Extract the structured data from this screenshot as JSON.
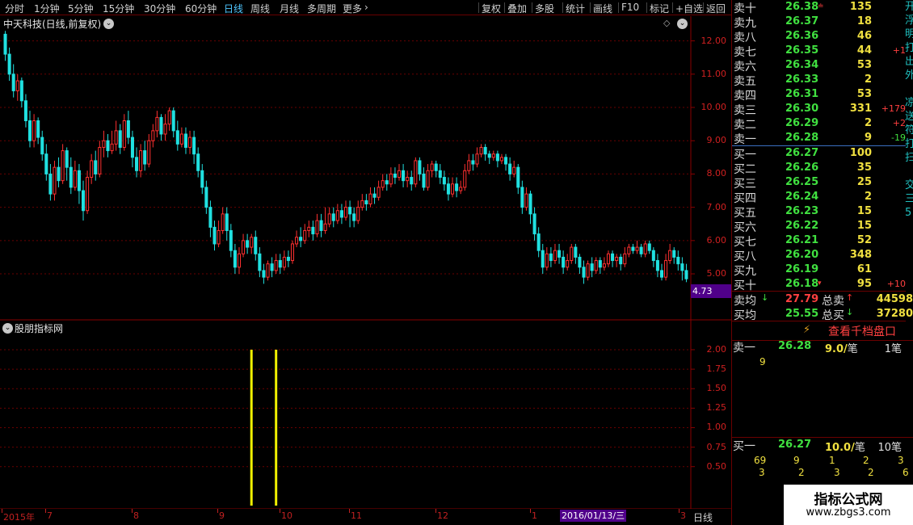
{
  "toolbar": {
    "left": [
      "分时",
      "1分钟",
      "5分钟",
      "15分钟",
      "30分钟",
      "60分钟",
      "日线",
      "周线",
      "月线",
      "多周期",
      "更多"
    ],
    "active": "日线",
    "right": [
      "复权",
      "叠加",
      "多股",
      "统计",
      "画线",
      "F10",
      "标记",
      "+自选",
      "返回"
    ]
  },
  "chart": {
    "title": "中天科技(日线,前复权)",
    "price_axis": [
      "12.00",
      "11.00",
      "10.00",
      "9.00",
      "8.00",
      "7.00",
      "6.00",
      "5.00"
    ],
    "last_price_tag": "4.73",
    "indicator_title": "股朋指标网",
    "indicator_axis": [
      "2.00",
      "1.75",
      "1.50",
      "1.25",
      "1.00",
      "0.75",
      "0.50"
    ],
    "dates": [
      "2015年",
      "7",
      "8",
      "9",
      "10",
      "11",
      "12",
      "1",
      "3"
    ],
    "cursor_date": "2016/01/13/三",
    "period": "日线"
  },
  "chart_data": {
    "type": "candlestick",
    "ylim": [
      4.2,
      12.5
    ],
    "candles": [
      [
        12.2,
        11.6,
        12.3,
        11.4
      ],
      [
        11.6,
        11.0,
        11.8,
        10.8
      ],
      [
        11.0,
        10.5,
        11.3,
        10.3
      ],
      [
        10.5,
        10.8,
        11.0,
        10.2
      ],
      [
        10.8,
        10.2,
        10.9,
        10.0
      ],
      [
        10.2,
        9.6,
        10.4,
        9.4
      ],
      [
        9.6,
        9.0,
        9.9,
        8.8
      ],
      [
        9.0,
        9.6,
        9.8,
        8.8
      ],
      [
        9.6,
        9.1,
        9.7,
        8.9
      ],
      [
        9.1,
        8.6,
        9.3,
        8.4
      ],
      [
        8.6,
        8.0,
        8.9,
        7.8
      ],
      [
        8.0,
        7.4,
        8.3,
        7.2
      ],
      [
        7.4,
        8.2,
        8.4,
        7.2
      ],
      [
        8.2,
        7.8,
        8.5,
        7.6
      ],
      [
        7.8,
        8.7,
        8.9,
        7.7
      ],
      [
        8.7,
        8.2,
        8.8,
        7.8
      ],
      [
        8.2,
        7.6,
        8.5,
        7.4
      ],
      [
        7.6,
        8.1,
        8.4,
        7.5
      ],
      [
        8.1,
        7.5,
        8.3,
        7.1
      ],
      [
        7.5,
        6.9,
        7.8,
        6.6
      ],
      [
        6.9,
        7.9,
        8.1,
        6.8
      ],
      [
        7.9,
        8.4,
        8.6,
        7.7
      ],
      [
        8.4,
        8.0,
        8.7,
        7.8
      ],
      [
        8.0,
        8.8,
        9.0,
        7.9
      ],
      [
        8.8,
        9.0,
        9.3,
        8.5
      ],
      [
        9.0,
        8.7,
        9.2,
        8.5
      ],
      [
        8.7,
        8.9,
        9.3,
        8.6
      ],
      [
        8.9,
        9.3,
        9.6,
        8.7
      ],
      [
        9.3,
        8.8,
        9.5,
        8.6
      ],
      [
        8.8,
        9.6,
        9.8,
        8.7
      ],
      [
        9.6,
        9.1,
        9.9,
        8.9
      ],
      [
        9.1,
        8.5,
        9.3,
        8.2
      ],
      [
        8.5,
        8.1,
        8.8,
        7.9
      ],
      [
        8.1,
        8.7,
        8.9,
        7.9
      ],
      [
        8.7,
        8.3,
        9.0,
        8.1
      ],
      [
        8.3,
        9.0,
        9.2,
        8.2
      ],
      [
        9.0,
        9.3,
        9.5,
        8.8
      ],
      [
        9.3,
        9.7,
        9.9,
        9.1
      ],
      [
        9.7,
        9.2,
        9.8,
        9.0
      ],
      [
        9.2,
        9.5,
        9.8,
        9.0
      ],
      [
        9.5,
        9.9,
        10.0,
        9.3
      ],
      [
        9.9,
        9.3,
        10.0,
        9.1
      ],
      [
        9.3,
        8.9,
        9.6,
        8.7
      ],
      [
        8.9,
        9.2,
        9.4,
        8.8
      ],
      [
        9.2,
        8.8,
        9.4,
        8.6
      ],
      [
        8.8,
        9.1,
        9.3,
        8.6
      ],
      [
        9.1,
        8.6,
        9.3,
        8.3
      ],
      [
        8.6,
        8.1,
        8.8,
        7.9
      ],
      [
        8.1,
        7.6,
        8.3,
        7.4
      ],
      [
        7.6,
        7.0,
        7.8,
        6.8
      ],
      [
        7.0,
        6.4,
        7.2,
        6.1
      ],
      [
        6.4,
        5.9,
        6.6,
        5.7
      ],
      [
        5.9,
        6.3,
        6.6,
        5.8
      ],
      [
        6.3,
        6.8,
        7.0,
        6.2
      ],
      [
        6.8,
        6.3,
        7.0,
        6.0
      ],
      [
        6.3,
        5.7,
        6.5,
        5.5
      ],
      [
        5.7,
        5.2,
        5.9,
        5.0
      ],
      [
        5.2,
        5.6,
        5.8,
        5.0
      ],
      [
        5.6,
        6.0,
        6.2,
        5.5
      ],
      [
        6.0,
        5.8,
        6.2,
        5.6
      ],
      [
        5.8,
        6.1,
        6.2,
        5.6
      ],
      [
        6.1,
        5.6,
        6.3,
        5.4
      ],
      [
        5.6,
        5.1,
        5.8,
        4.9
      ],
      [
        5.1,
        4.9,
        5.3,
        4.7
      ],
      [
        4.9,
        5.3,
        5.4,
        4.8
      ],
      [
        5.3,
        5.1,
        5.5,
        4.9
      ],
      [
        5.1,
        5.4,
        5.6,
        5.0
      ],
      [
        5.4,
        5.2,
        5.6,
        5.0
      ],
      [
        5.2,
        5.5,
        5.7,
        5.1
      ],
      [
        5.5,
        5.4,
        5.7,
        5.2
      ],
      [
        5.4,
        5.9,
        6.0,
        5.3
      ],
      [
        5.9,
        6.1,
        6.3,
        5.8
      ],
      [
        6.1,
        6.0,
        6.4,
        5.8
      ],
      [
        6.0,
        6.3,
        6.5,
        5.9
      ],
      [
        6.3,
        6.4,
        6.6,
        6.1
      ],
      [
        6.4,
        6.2,
        6.6,
        6.0
      ],
      [
        6.2,
        6.6,
        6.8,
        6.1
      ],
      [
        6.6,
        6.3,
        6.8,
        6.1
      ],
      [
        6.3,
        6.5,
        7.0,
        6.2
      ],
      [
        6.5,
        6.8,
        7.0,
        6.4
      ],
      [
        6.8,
        6.6,
        7.0,
        6.4
      ],
      [
        6.6,
        6.9,
        7.1,
        6.5
      ],
      [
        6.9,
        6.7,
        7.1,
        6.5
      ],
      [
        6.7,
        7.0,
        7.2,
        6.6
      ],
      [
        7.0,
        6.8,
        7.2,
        6.4
      ],
      [
        6.8,
        6.6,
        7.0,
        6.4
      ],
      [
        6.6,
        7.0,
        7.2,
        6.5
      ],
      [
        7.0,
        7.2,
        7.4,
        6.9
      ],
      [
        7.2,
        7.1,
        7.4,
        6.9
      ],
      [
        7.1,
        7.4,
        7.6,
        7.0
      ],
      [
        7.4,
        7.3,
        7.6,
        7.1
      ],
      [
        7.3,
        7.6,
        7.8,
        7.2
      ],
      [
        7.6,
        7.8,
        8.0,
        7.5
      ],
      [
        7.8,
        7.7,
        8.0,
        7.5
      ],
      [
        7.7,
        8.0,
        8.2,
        7.6
      ],
      [
        8.0,
        7.9,
        8.2,
        7.7
      ],
      [
        7.9,
        8.1,
        8.3,
        7.8
      ],
      [
        8.1,
        7.8,
        8.3,
        7.6
      ],
      [
        7.8,
        7.9,
        8.1,
        7.6
      ],
      [
        7.9,
        7.7,
        8.1,
        7.5
      ],
      [
        7.7,
        8.4,
        8.5,
        7.6
      ],
      [
        8.4,
        8.0,
        8.5,
        7.8
      ],
      [
        8.0,
        7.6,
        8.2,
        7.5
      ],
      [
        7.6,
        8.1,
        8.3,
        7.5
      ],
      [
        8.1,
        8.3,
        8.4,
        7.9
      ],
      [
        8.3,
        8.1,
        8.4,
        7.9
      ],
      [
        8.1,
        7.9,
        8.3,
        7.7
      ],
      [
        7.9,
        7.7,
        8.1,
        7.5
      ],
      [
        7.7,
        7.4,
        7.9,
        7.2
      ],
      [
        7.4,
        7.7,
        7.9,
        7.3
      ],
      [
        7.7,
        7.5,
        7.9,
        7.3
      ],
      [
        7.5,
        7.6,
        7.8,
        7.4
      ],
      [
        7.6,
        8.1,
        8.3,
        7.5
      ],
      [
        8.1,
        8.4,
        8.6,
        8.0
      ],
      [
        8.4,
        8.3,
        8.6,
        8.1
      ],
      [
        8.3,
        8.6,
        8.8,
        8.2
      ],
      [
        8.6,
        8.8,
        8.9,
        8.5
      ],
      [
        8.8,
        8.6,
        8.9,
        8.4
      ],
      [
        8.6,
        8.5,
        8.7,
        8.3
      ],
      [
        8.5,
        8.6,
        8.7,
        8.4
      ],
      [
        8.6,
        8.4,
        8.7,
        8.2
      ],
      [
        8.4,
        8.5,
        8.6,
        8.3
      ],
      [
        8.5,
        8.3,
        8.6,
        8.1
      ],
      [
        8.3,
        8.0,
        8.5,
        7.8
      ],
      [
        8.0,
        8.2,
        8.4,
        7.9
      ],
      [
        8.2,
        7.6,
        8.3,
        7.4
      ],
      [
        7.6,
        7.0,
        7.8,
        6.8
      ],
      [
        7.0,
        7.4,
        7.6,
        6.9
      ],
      [
        7.4,
        6.8,
        7.5,
        6.5
      ],
      [
        6.8,
        6.2,
        7.0,
        6.0
      ],
      [
        6.2,
        5.7,
        6.4,
        5.5
      ],
      [
        5.7,
        5.2,
        5.9,
        5.0
      ],
      [
        5.2,
        5.6,
        5.8,
        5.1
      ],
      [
        5.6,
        5.4,
        5.8,
        5.2
      ],
      [
        5.4,
        5.7,
        5.9,
        5.3
      ],
      [
        5.7,
        5.5,
        5.9,
        5.3
      ],
      [
        5.5,
        5.2,
        5.7,
        5.0
      ],
      [
        5.2,
        5.4,
        5.6,
        5.1
      ],
      [
        5.4,
        5.8,
        5.9,
        5.3
      ],
      [
        5.8,
        5.5,
        5.9,
        5.3
      ],
      [
        5.5,
        5.2,
        5.6,
        5.0
      ],
      [
        5.2,
        4.9,
        5.4,
        4.7
      ],
      [
        4.9,
        5.3,
        5.4,
        4.8
      ],
      [
        5.3,
        5.1,
        5.5,
        4.9
      ],
      [
        5.1,
        5.4,
        5.5,
        5.0
      ],
      [
        5.4,
        5.2,
        5.5,
        5.0
      ],
      [
        5.2,
        5.3,
        5.5,
        5.1
      ],
      [
        5.3,
        5.6,
        5.7,
        5.2
      ],
      [
        5.6,
        5.4,
        5.7,
        5.2
      ],
      [
        5.4,
        5.5,
        5.6,
        5.2
      ],
      [
        5.5,
        5.3,
        5.6,
        5.1
      ],
      [
        5.3,
        5.6,
        5.8,
        5.2
      ],
      [
        5.6,
        5.8,
        5.9,
        5.5
      ],
      [
        5.8,
        5.7,
        5.9,
        5.6
      ],
      [
        5.7,
        5.8,
        6.0,
        5.6
      ],
      [
        5.8,
        5.6,
        5.9,
        5.5
      ],
      [
        5.6,
        5.9,
        6.0,
        5.5
      ],
      [
        5.9,
        5.7,
        6.0,
        5.6
      ],
      [
        5.7,
        5.4,
        5.8,
        5.2
      ],
      [
        5.4,
        5.1,
        5.6,
        4.9
      ],
      [
        5.1,
        4.9,
        5.3,
        4.8
      ],
      [
        4.9,
        5.4,
        5.6,
        4.8
      ],
      [
        5.4,
        5.7,
        5.9,
        5.3
      ],
      [
        5.7,
        5.5,
        5.8,
        5.3
      ],
      [
        5.5,
        5.3,
        5.7,
        5.1
      ],
      [
        5.3,
        5.1,
        5.5,
        4.8
      ],
      [
        5.1,
        4.85,
        5.3,
        4.75
      ]
    ],
    "indicator": {
      "ylim": [
        0,
        2.3
      ],
      "bars": [
        {
          "index": 60,
          "value": 2.0
        },
        {
          "index": 66,
          "value": 2.0
        }
      ]
    }
  },
  "order_book": {
    "asks": [
      {
        "name": "卖十",
        "price": "26.38",
        "vol": "135",
        "change": "",
        "mark": "≐"
      },
      {
        "name": "卖九",
        "price": "26.37",
        "vol": "18",
        "change": "",
        "mark": ""
      },
      {
        "name": "卖八",
        "price": "26.36",
        "vol": "46",
        "change": "",
        "mark": ""
      },
      {
        "name": "卖七",
        "price": "26.35",
        "vol": "44",
        "change": "+1",
        "mark": ""
      },
      {
        "name": "卖六",
        "price": "26.34",
        "vol": "53",
        "change": "",
        "mark": ""
      },
      {
        "name": "卖五",
        "price": "26.33",
        "vol": "2",
        "change": "",
        "mark": ""
      },
      {
        "name": "卖四",
        "price": "26.31",
        "vol": "53",
        "change": "",
        "mark": ""
      },
      {
        "name": "卖三",
        "price": "26.30",
        "vol": "331",
        "change": "+179",
        "mark": ""
      },
      {
        "name": "卖二",
        "price": "26.29",
        "vol": "2",
        "change": "+2",
        "mark": ""
      },
      {
        "name": "卖一",
        "price": "26.28",
        "vol": "9",
        "change": "-19",
        "mark": ""
      }
    ],
    "bids": [
      {
        "name": "买一",
        "price": "26.27",
        "vol": "100",
        "change": "",
        "mark": ""
      },
      {
        "name": "买二",
        "price": "26.26",
        "vol": "35",
        "change": "",
        "mark": ""
      },
      {
        "name": "买三",
        "price": "26.25",
        "vol": "25",
        "change": "",
        "mark": ""
      },
      {
        "name": "买四",
        "price": "26.24",
        "vol": "2",
        "change": "",
        "mark": ""
      },
      {
        "name": "买五",
        "price": "26.23",
        "vol": "15",
        "change": "",
        "mark": ""
      },
      {
        "name": "买六",
        "price": "26.22",
        "vol": "15",
        "change": "",
        "mark": ""
      },
      {
        "name": "买七",
        "price": "26.21",
        "vol": "52",
        "change": "",
        "mark": ""
      },
      {
        "name": "买八",
        "price": "26.20",
        "vol": "348",
        "change": "",
        "mark": ""
      },
      {
        "name": "买九",
        "price": "26.19",
        "vol": "61",
        "change": "",
        "mark": ""
      },
      {
        "name": "买十",
        "price": "26.18",
        "vol": "95",
        "change": "+10",
        "mark": "▾"
      }
    ]
  },
  "totals": {
    "ask_avg_label": "卖均",
    "ask_avg": "27.79",
    "ask_total_label": "总卖",
    "ask_total": "44598",
    "bid_avg_label": "买均",
    "bid_avg": "25.55",
    "bid_total_label": "总买",
    "bid_total": "37280"
  },
  "depth_link": "查看千档盘口",
  "queue": {
    "ask": {
      "name": "卖一",
      "price": "26.28",
      "amount": "9.0/",
      "unit": "笔",
      "count": "1笔",
      "orders": [
        "9"
      ]
    },
    "bid": {
      "name": "买一",
      "price": "26.27",
      "amount": "10.0/",
      "unit": "笔",
      "count": "10笔",
      "orders_row1": [
        "69",
        "9",
        "1",
        "2",
        "3"
      ],
      "orders_row2": [
        "3",
        "2",
        "3",
        "2",
        "6"
      ]
    }
  },
  "right_edge_chars": "开\n浮\n明\n打\n出\n外\n\n凉\n送\n符\n打\n扫\n\n交\n三\n5",
  "watermark": {
    "title": "指标公式网",
    "url": "www.zbgs3.com"
  },
  "colors": {
    "up": "#ff3030",
    "down": "#20e0e0",
    "grid": "#6a0000",
    "accent": "#4ec6ff",
    "indicator": "#f0f000"
  }
}
